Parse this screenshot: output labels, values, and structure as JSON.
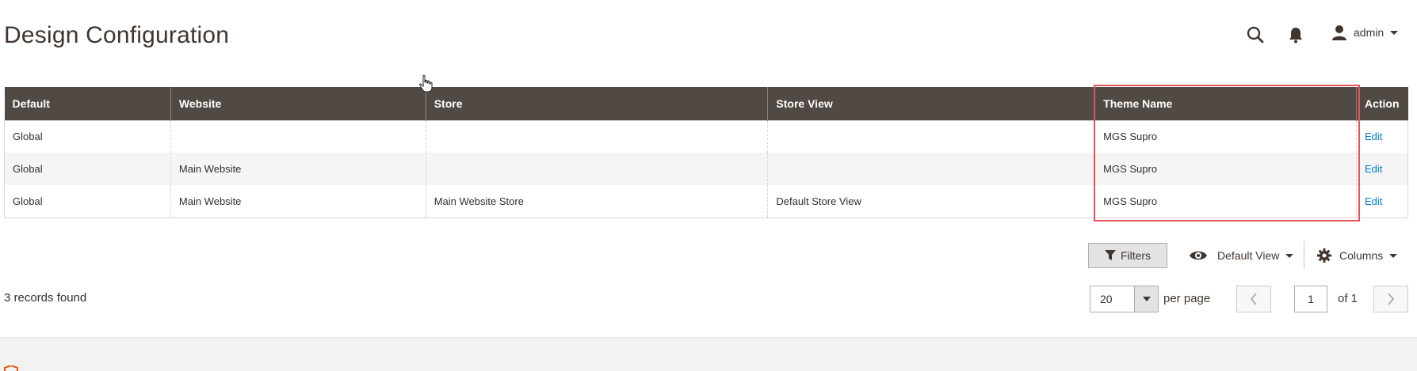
{
  "page": {
    "title": "Design Configuration"
  },
  "header": {
    "user_label": "admin"
  },
  "grid": {
    "columns": [
      "Default",
      "Website",
      "Store",
      "Store View",
      "Theme Name",
      "Action"
    ],
    "rows": [
      {
        "default": "Global",
        "website": "",
        "store": "",
        "store_view": "",
        "theme": "MGS Supro",
        "action": "Edit"
      },
      {
        "default": "Global",
        "website": "Main Website",
        "store": "",
        "store_view": "",
        "theme": "MGS Supro",
        "action": "Edit"
      },
      {
        "default": "Global",
        "website": "Main Website",
        "store": "Main Website Store",
        "store_view": "Default Store View",
        "theme": "MGS Supro",
        "action": "Edit"
      }
    ]
  },
  "toolbar": {
    "filters_label": "Filters",
    "view_label": "Default View",
    "columns_label": "Columns",
    "records_found": "3 records found",
    "per_page_value": "20",
    "per_page_label": "per page",
    "page_value": "1",
    "page_of": "of 1"
  },
  "colors": {
    "header_bg": "#514943",
    "link": "#007bdb",
    "highlight": "#e8525a"
  }
}
